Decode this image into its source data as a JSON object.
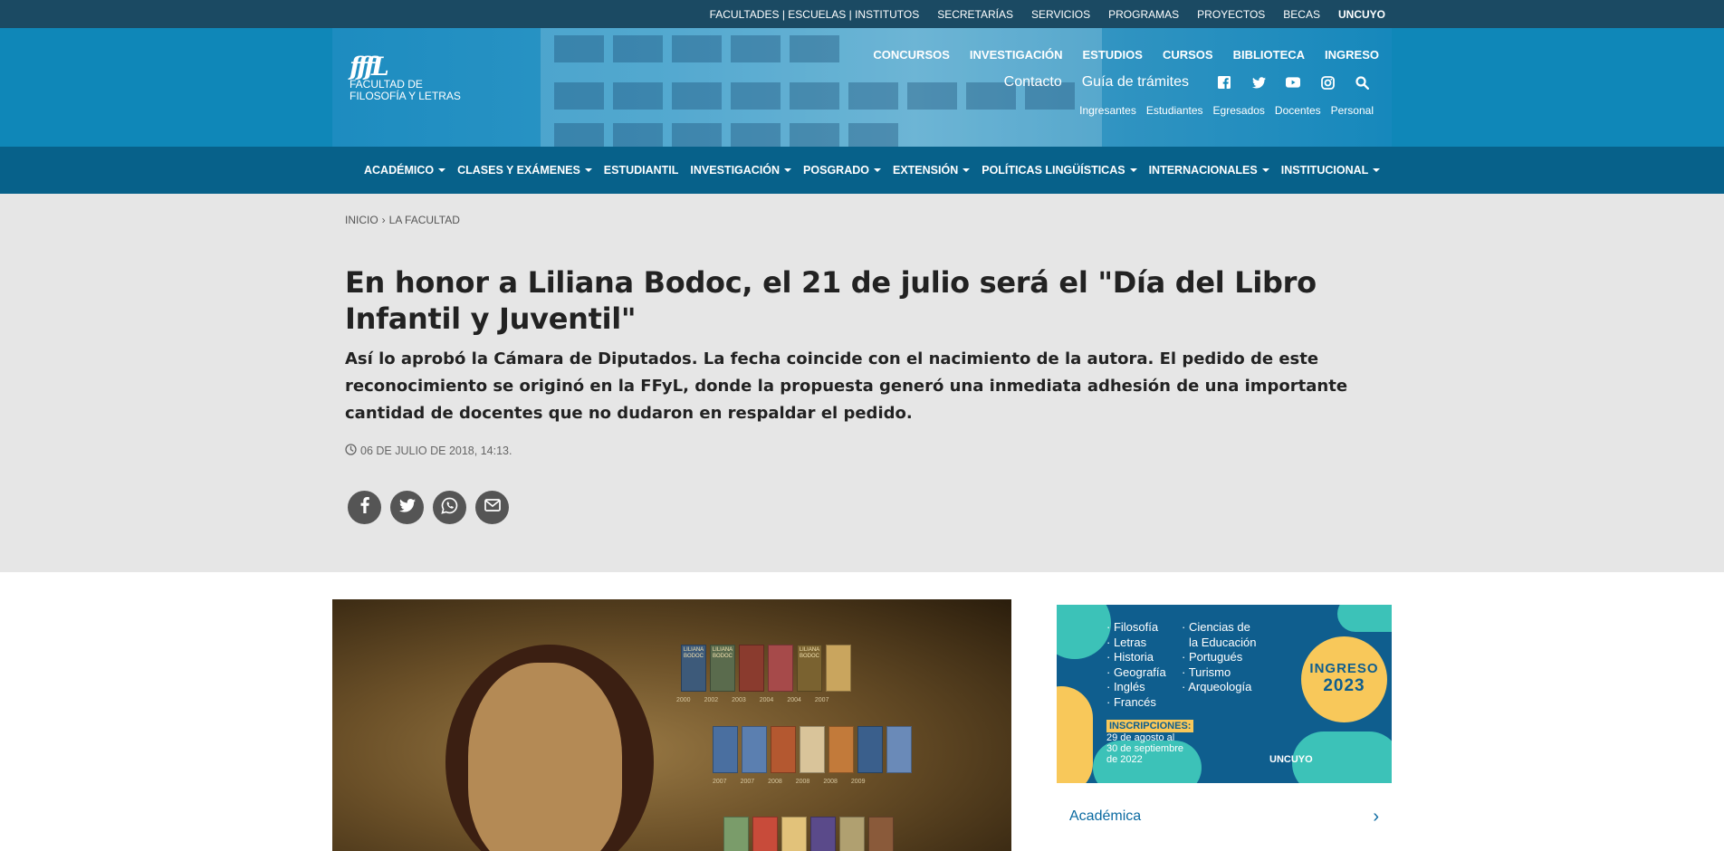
{
  "topbar": {
    "links": [
      "FACULTADES | ESCUELAS | INSTITUTOS",
      "SECRETARÍAS",
      "SERVICIOS",
      "PROGRAMAS",
      "PROYECTOS",
      "BECAS",
      "UNCUYO"
    ]
  },
  "header": {
    "logo_mark": "fffL",
    "logo_line1": "FACULTAD DE",
    "logo_line2": "FILOSOFÍA Y LETRAS",
    "nav1": [
      "CONCURSOS",
      "INVESTIGACIÓN",
      "ESTUDIOS",
      "CURSOS",
      "BIBLIOTECA",
      "INGRESO"
    ],
    "nav2": [
      "Contacto",
      "Guía de trámites"
    ],
    "social_icons": [
      "facebook-icon",
      "twitter-icon",
      "youtube-icon",
      "instagram-icon",
      "search-icon"
    ],
    "nav3": [
      "Ingresantes",
      "Estudiantes",
      "Egresados",
      "Docentes",
      "Personal"
    ]
  },
  "mainnav": {
    "items": [
      {
        "label": "ACADÉMICO",
        "dropdown": true
      },
      {
        "label": "CLASES Y EXÁMENES",
        "dropdown": true
      },
      {
        "label": "ESTUDIANTIL",
        "dropdown": false
      },
      {
        "label": "INVESTIGACIÓN",
        "dropdown": true
      },
      {
        "label": "POSGRADO",
        "dropdown": true
      },
      {
        "label": "EXTENSIÓN",
        "dropdown": true
      },
      {
        "label": "POLÍTICAS LINGÜÍSTICAS",
        "dropdown": true
      },
      {
        "label": "INTERNACIONALES",
        "dropdown": true
      },
      {
        "label": "INSTITUCIONAL",
        "dropdown": true
      }
    ]
  },
  "article": {
    "breadcrumb": [
      "INICIO",
      "›",
      "LA FACULTAD"
    ],
    "title": "En honor a Liliana Bodoc, el 21 de julio será el \"Día del Libro Infantil y Juventil\"",
    "subtitle": "Así lo aprobó la Cámara de Diputados. La fecha coincide con el nacimiento de la autora. El pedido de este reconocimiento se originó en la FFyL, donde la propuesta generó una inmediata adhesión de una importante cantidad de docentes que no dudaron en respaldar el pedido.",
    "date": "06 DE JULIO DE 2018, 14:13.",
    "share_icons": [
      "facebook-icon",
      "twitter-icon",
      "whatsapp-icon",
      "email-icon"
    ]
  },
  "photo": {
    "book_labels": [
      "LILIANA BODOC",
      "LILIANA BODOC",
      "LILIANA BODOC"
    ],
    "years": [
      "2000",
      "2002",
      "2003",
      "2004",
      "2004",
      "2007",
      "2007",
      "2007",
      "2008",
      "2008",
      "2008",
      "2009"
    ]
  },
  "sidebar": {
    "banner": {
      "col1": [
        "· Filosofía",
        "· Letras",
        "· Historia",
        "· Geografía",
        "· Inglés",
        "· Francés"
      ],
      "col2": [
        "· Ciencias de",
        "  la Educación",
        "· Portugués",
        "· Turismo",
        "· Arqueología"
      ],
      "ingreso_label": "INGRESO",
      "ingreso_year": "2023",
      "inscripciones_label": "INSCRIPCIONES:",
      "inscripciones_dates_1": "29 de agosto al",
      "inscripciones_dates_2": "30 de septiembre",
      "inscripciones_dates_3": "de 2022",
      "uncuyo_label": "UNCUYO",
      "colors": {
        "bg": "#0f5e8e",
        "ingreso": "#f8c85a",
        "inscripciones": "#f8c85a"
      }
    },
    "academica_label": "Académica",
    "academica_chevron": "›"
  },
  "colors": {
    "topbar": "#1b4a63",
    "header": "#0f87b8",
    "mainnav": "#07618a",
    "article_bg": "#e6e6e6",
    "link": "#0a6aa1"
  }
}
